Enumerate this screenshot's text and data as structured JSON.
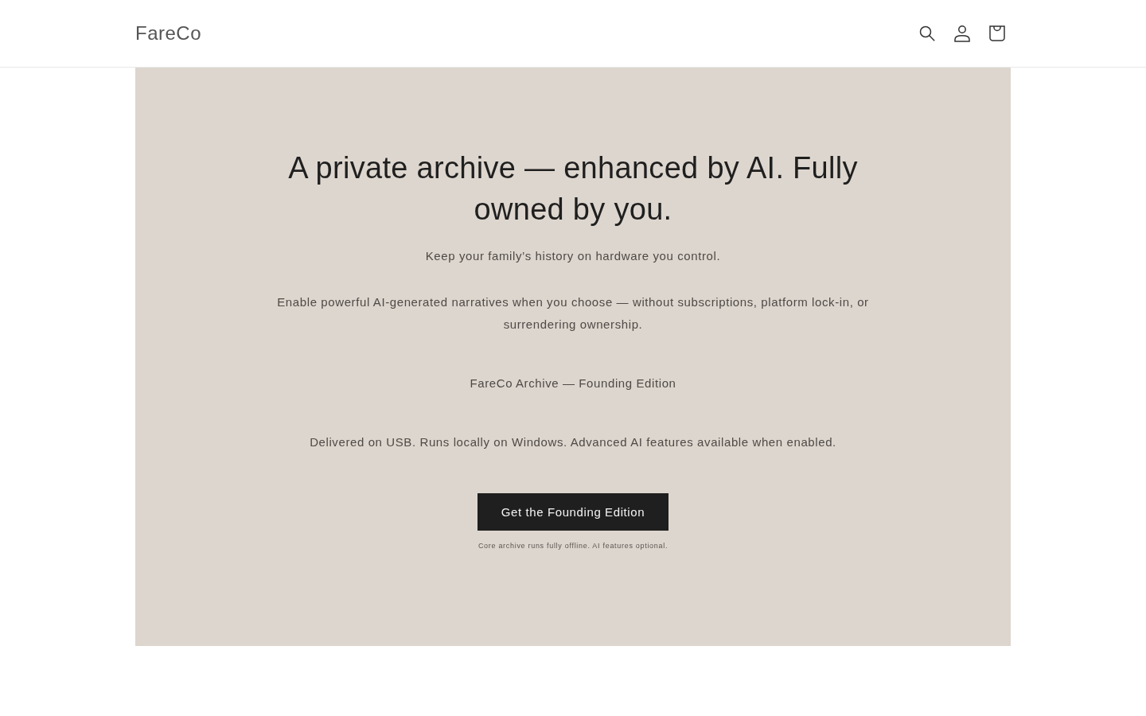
{
  "header": {
    "logo": "FareCo"
  },
  "hero": {
    "heading": "A private archive — enhanced by AI. Fully owned by you.",
    "paragraphs": [
      "Keep your family’s history on hardware you control.",
      "Enable powerful AI-generated narratives when you choose — without subscriptions, platform lock-in, or surrendering ownership.",
      "FareCo Archive — Founding Edition",
      "Delivered on USB. Runs locally on Windows. Advanced AI features available when enabled."
    ],
    "button": "Get the Founding Edition",
    "note": "Core archive runs fully offline. AI features optional."
  }
}
